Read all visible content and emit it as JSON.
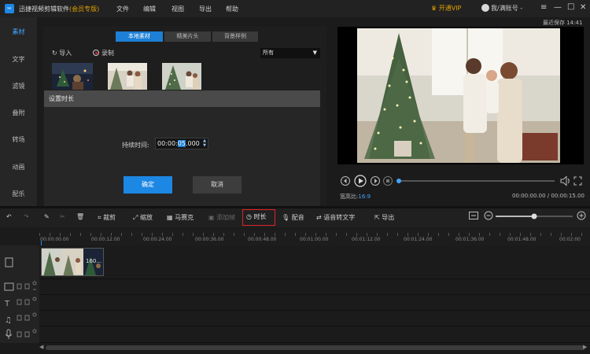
{
  "app": {
    "title": "迅捷视频剪辑软件",
    "vip_tag": "(会员专版)",
    "menu": [
      "文件",
      "编辑",
      "视图",
      "导出",
      "帮助"
    ],
    "vip_button": "开通VIP",
    "account": "我/满账号 -",
    "last_save": "最近保存 14:41",
    "colors": {
      "accent": "#1d87e4",
      "vip": "#e3a100",
      "highlight": "#e0232a"
    }
  },
  "sidebar": {
    "items": [
      {
        "label": "素材",
        "active": true
      },
      {
        "label": "文字"
      },
      {
        "label": "滤镜"
      },
      {
        "label": "叠附"
      },
      {
        "label": "转场"
      },
      {
        "label": "动画"
      },
      {
        "label": "配乐"
      }
    ]
  },
  "media": {
    "tabs": [
      "本地素材",
      "精美片头",
      "背景样例"
    ],
    "active_tab": "本地素材",
    "import_label": "导入",
    "record_label": "录制",
    "filter_value": "所有",
    "thumbnails": [
      "christmas-room",
      "family-portrait",
      "christmas-tree"
    ]
  },
  "dialog": {
    "title": "设置时长",
    "duration_label": "持续时间:",
    "duration_pre": "00:00:",
    "duration_sel": "05",
    "duration_post": ".000",
    "ok_label": "确定",
    "cancel_label": "取消"
  },
  "player": {
    "aspect_label": "宽高比:",
    "aspect_value": "16:9",
    "timecode": "00:00:00.00 / 00:00:15.00",
    "progress": 0
  },
  "toolbar": {
    "crop": "裁剪",
    "zoom": "缩放",
    "mosaic": "马赛克",
    "freeze": "添加帧",
    "duration": "时长",
    "voiceover": "配音",
    "speech_to_text": "语音转文字",
    "export": "导出",
    "zoom_level": 0.5
  },
  "timeline": {
    "ticks": [
      "00:00:00.00",
      "00:00:12.00",
      "00:00:24.00",
      "00:00:36.00",
      "00:00:48.00",
      "00:01:00.00",
      "00:01:12.00",
      "00:01:24.00",
      "00:01:36.00",
      "00:01:48.00",
      "00:02:00"
    ],
    "clip_label": "160..."
  }
}
